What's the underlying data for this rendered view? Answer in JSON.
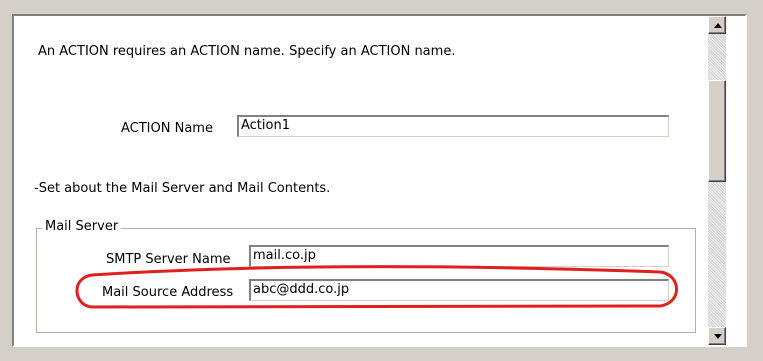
{
  "dialog": {
    "intro_text": "An ACTION requires an ACTION name. Specify an ACTION name.",
    "action_name_label": "ACTION Name",
    "action_name_value": "Action1",
    "section_text": "-Set about the Mail Server and Mail Contents.",
    "mail_server": {
      "legend": "Mail Server",
      "smtp_label": "SMTP Server Name",
      "smtp_value": "mail.co.jp",
      "source_label": "Mail Source Address",
      "source_value": "abc@ddd.co.jp"
    }
  },
  "colors": {
    "highlight": "#e0201e",
    "face": "#d4d0c8"
  },
  "icons": [
    "scroll-up-arrow-icon",
    "scroll-down-arrow-icon"
  ]
}
